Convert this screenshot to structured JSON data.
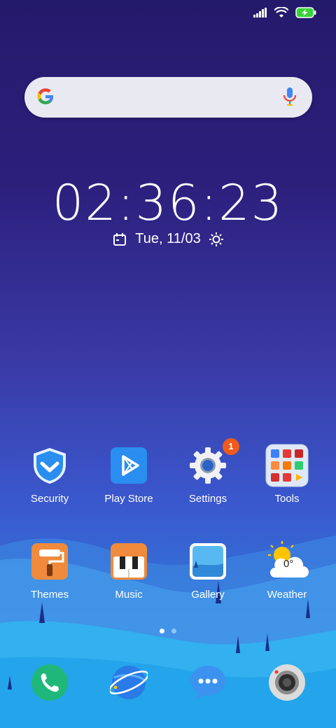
{
  "search": {
    "placeholder": ""
  },
  "clock": {
    "time": "02:36:23",
    "date": "Tue, 11/03"
  },
  "apps_row1": [
    {
      "label": "Security",
      "icon": "shield-icon"
    },
    {
      "label": "Play Store",
      "icon": "play-store-icon"
    },
    {
      "label": "Settings",
      "icon": "gear-icon",
      "badge": "1"
    },
    {
      "label": "Tools",
      "icon": "tools-folder-icon"
    }
  ],
  "apps_row2": [
    {
      "label": "Themes",
      "icon": "paint-roller-icon"
    },
    {
      "label": "Music",
      "icon": "piano-icon"
    },
    {
      "label": "Gallery",
      "icon": "gallery-icon"
    },
    {
      "label": "Weather",
      "icon": "weather-icon",
      "temp": "0°"
    }
  ],
  "dock": [
    "phone-icon",
    "browser-icon",
    "messages-icon",
    "camera-icon"
  ],
  "colors": {
    "badge": "#f05a1a",
    "accent": "#2a95e2"
  }
}
